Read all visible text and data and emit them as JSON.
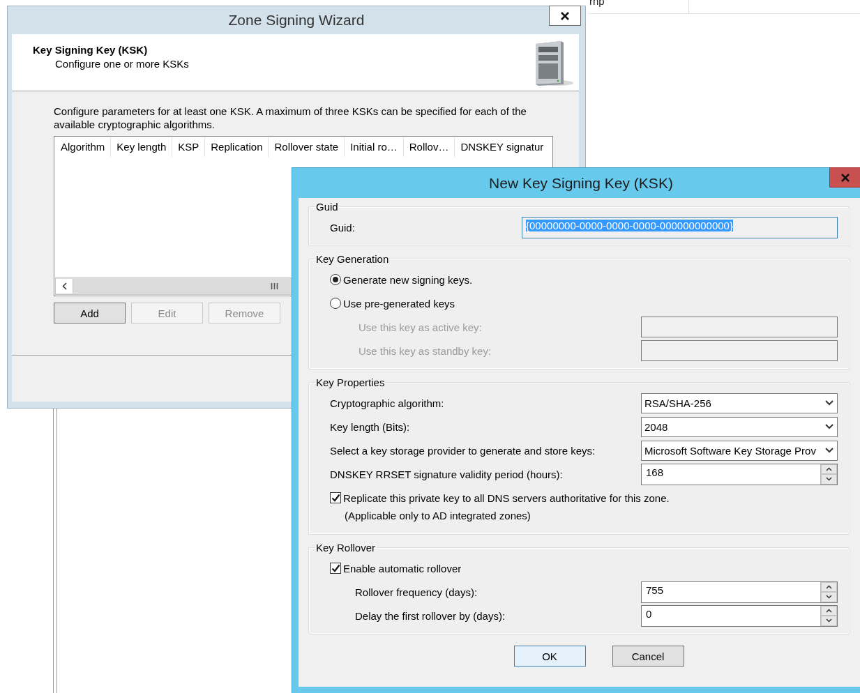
{
  "background_window": {
    "column_1": "rnp"
  },
  "wizard": {
    "title": "Zone Signing Wizard",
    "header": {
      "title": "Key Signing Key (KSK)",
      "subtitle": "Configure one or more KSKs"
    },
    "description": "Configure parameters for at least one KSK. A maximum of three KSKs can be specified for each of the available cryptographic algorithms.",
    "table": {
      "columns": [
        "Algorithm",
        "Key length",
        "KSP",
        "Replication",
        "Rollover state",
        "Initial ro…",
        "Rollov…",
        "DNSKEY signatur"
      ]
    },
    "buttons": [
      {
        "label": "Add",
        "disabled": false
      },
      {
        "label": "Edit",
        "disabled": true
      },
      {
        "label": "Remove",
        "disabled": true
      }
    ]
  },
  "dialog": {
    "title": "New Key Signing Key (KSK)",
    "groups": [
      {
        "label": "Guid",
        "items": [
          {
            "kind": "wide_text",
            "label": "Guid:",
            "value": "{00000000-0000-0000-0000-000000000000}",
            "highlighted": true
          }
        ]
      },
      {
        "label": "Key Generation",
        "items": [
          {
            "kind": "radio",
            "label": "Generate new signing keys.",
            "selected": true
          },
          {
            "kind": "radio",
            "label": "Use pre-generated keys",
            "selected": false,
            "children": [
              {
                "kind": "text",
                "label": "Use this key as active key:",
                "disabled": true
              },
              {
                "kind": "text",
                "label": "Use this key as standby key:",
                "disabled": true
              }
            ]
          }
        ]
      },
      {
        "label": "Key Properties",
        "items": [
          {
            "kind": "dropdown",
            "label": "Cryptographic algorithm:",
            "value": "RSA/SHA-256"
          },
          {
            "kind": "dropdown",
            "label": "Key length (Bits):",
            "value": "2048"
          },
          {
            "kind": "dropdown",
            "label": "Select a key storage provider to generate and store keys:",
            "value": "Microsoft Software Key Storage Prov"
          },
          {
            "kind": "spinner",
            "label": "DNSKEY RRSET signature validity period (hours):",
            "value": "168"
          },
          {
            "kind": "checkbox",
            "label": "Replicate this private key to all DNS servers authoritative for this zone.",
            "checked": true,
            "note": "(Applicable only to AD integrated zones)"
          }
        ]
      },
      {
        "label": "Key Rollover",
        "items": [
          {
            "kind": "checkbox",
            "label": "Enable automatic rollover",
            "checked": true,
            "children": [
              {
                "kind": "spinner",
                "label": "Rollover frequency (days):",
                "value": "755"
              },
              {
                "kind": "spinner",
                "label": "Delay the first rollover by (days):",
                "value": "0"
              }
            ]
          }
        ]
      }
    ],
    "buttons": [
      {
        "label": "OK",
        "default": true
      },
      {
        "label": "Cancel",
        "default": false
      }
    ]
  }
}
